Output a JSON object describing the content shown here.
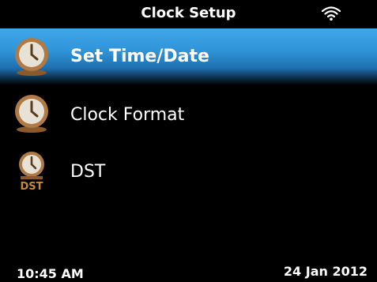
{
  "header": {
    "title": "Clock Setup",
    "wifi_icon": "wifi-icon"
  },
  "menu": {
    "items": [
      {
        "label": "Set Time/Date",
        "icon": "clock-icon",
        "selected": true
      },
      {
        "label": "Clock Format",
        "icon": "clock-icon",
        "selected": false
      },
      {
        "label": "DST",
        "icon": "clock-dst-icon",
        "icon_text": "DST",
        "selected": false
      }
    ]
  },
  "footer": {
    "time": "10:45 AM",
    "date": "24 Jan 2012"
  },
  "colors": {
    "background": "#000000",
    "selection": "#2f93d8",
    "icon_bronze": "#b07a45",
    "text": "#ffffff"
  }
}
